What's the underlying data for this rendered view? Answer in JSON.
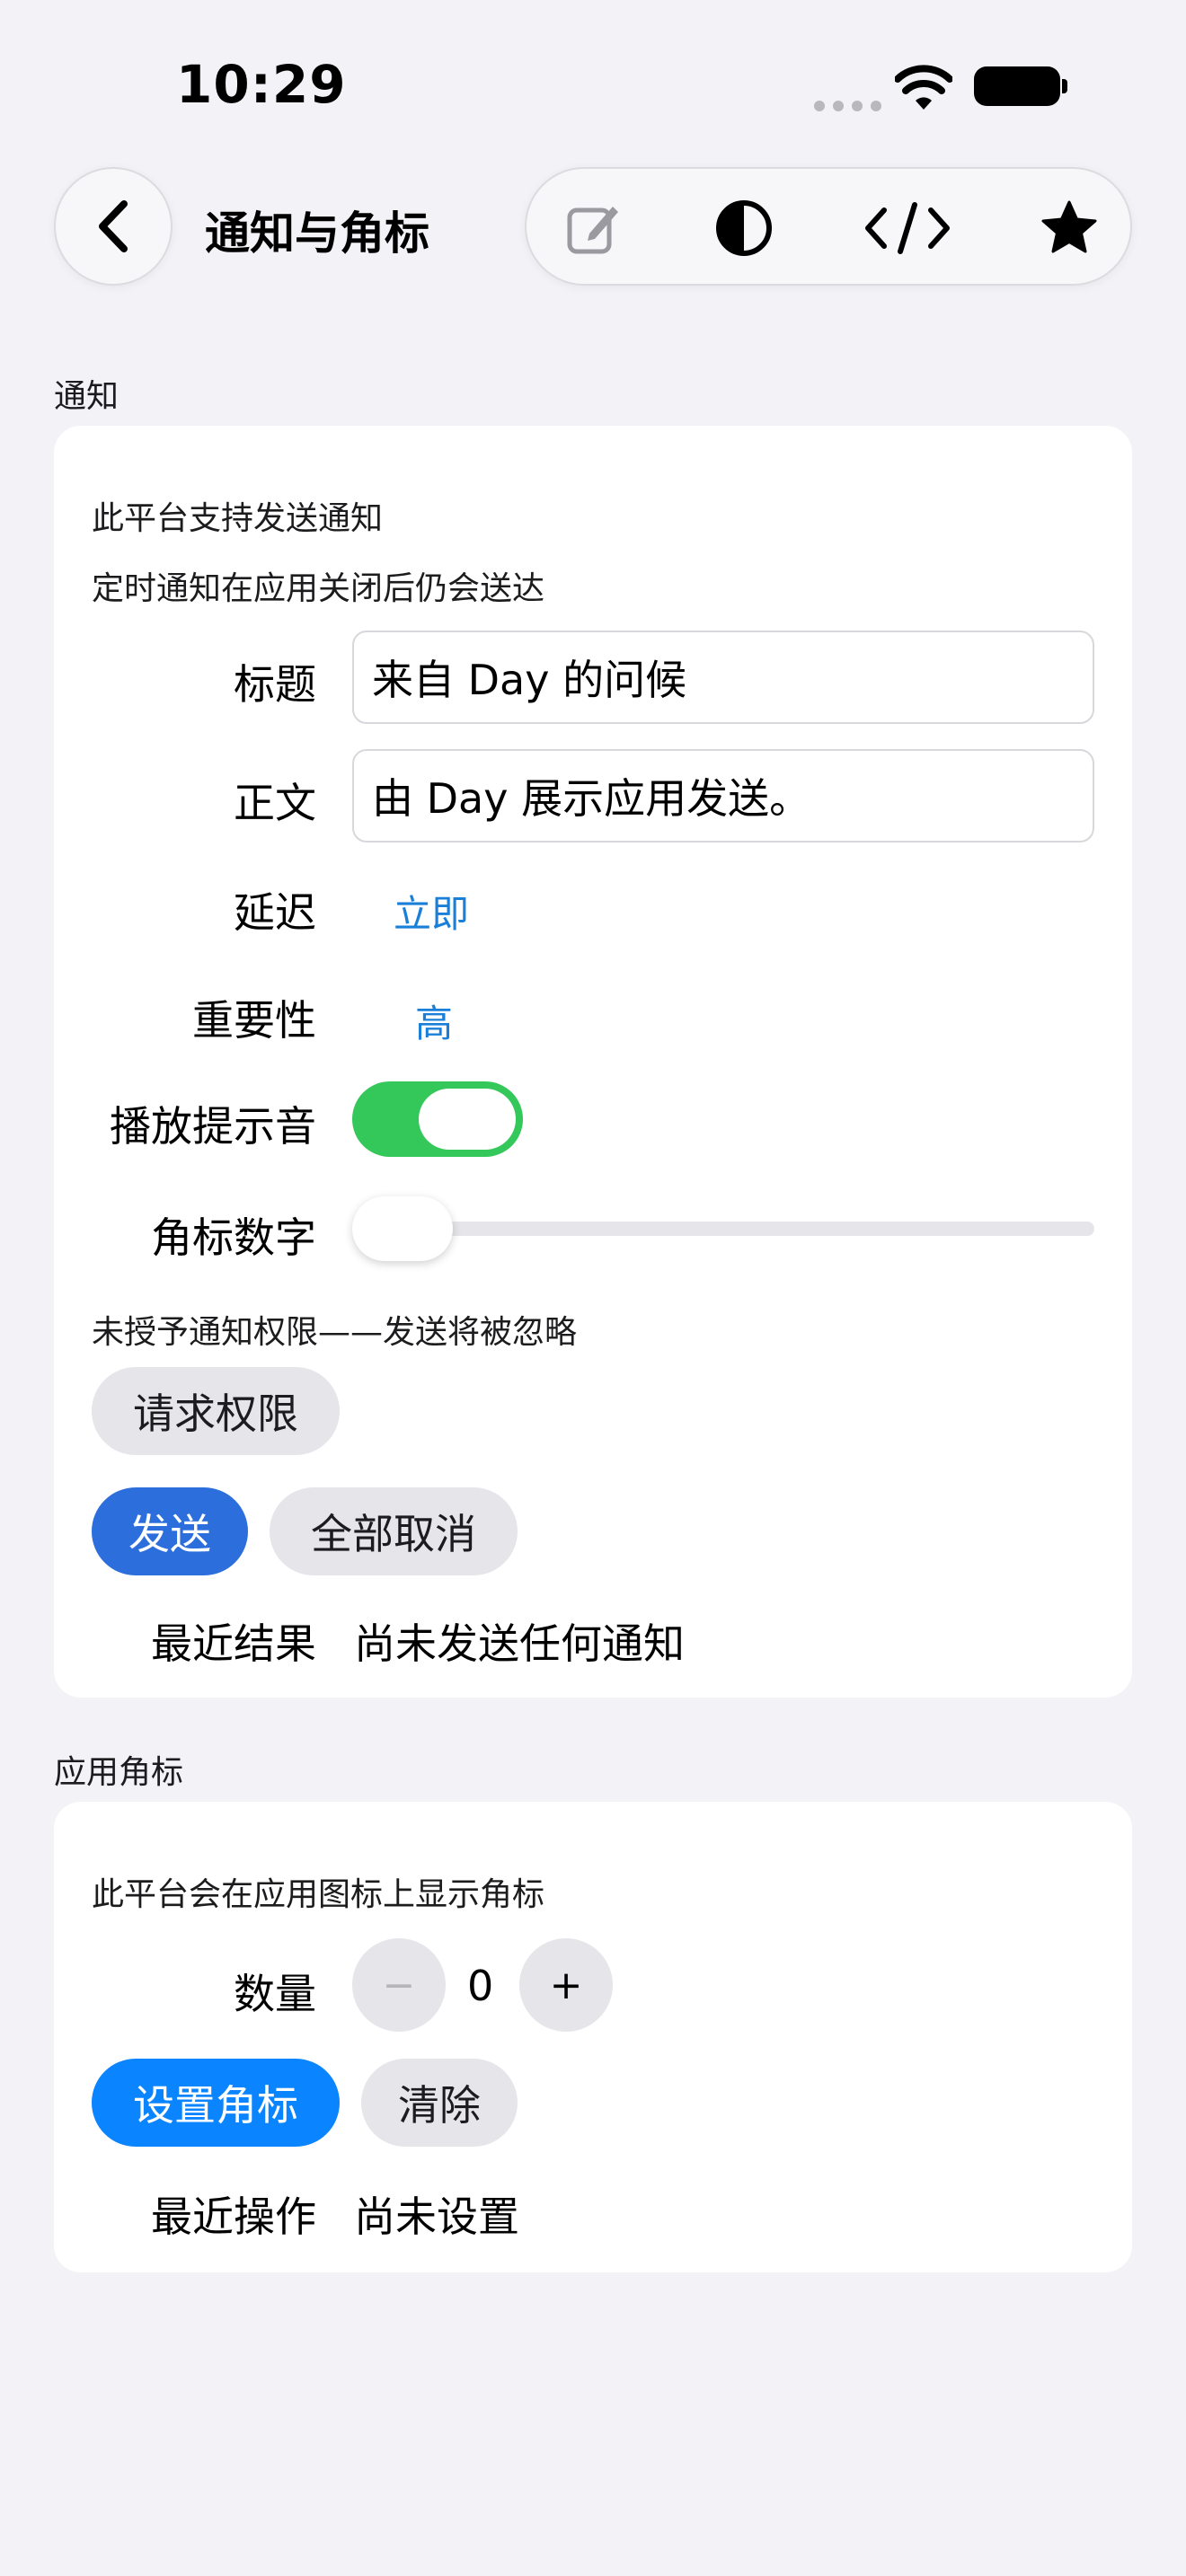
{
  "status_bar": {
    "time": "10:29"
  },
  "nav": {
    "title": "通知与角标",
    "icons": [
      "back-chevron-icon",
      "compose-icon",
      "contrast-icon",
      "code-icon",
      "star-icon"
    ]
  },
  "notification_section": {
    "header": "通知",
    "support_note": "此平台支持发送通知",
    "scheduled_note": "定时通知在应用关闭后仍会送达",
    "title_label": "标题",
    "title_value": "来自 Day 的问候",
    "body_label": "正文",
    "body_value": "由 Day 展示应用发送。",
    "delay_label": "延迟",
    "delay_value": "立即",
    "importance_label": "重要性",
    "importance_value": "高",
    "sound_label": "播放提示音",
    "sound_on": true,
    "badge_number_label": "角标数字",
    "badge_number_slider_fraction": 0,
    "permission_note": "未授予通知权限——发送将被忽略",
    "request_permission_button": "请求权限",
    "send_button": "发送",
    "cancel_all_button": "全部取消",
    "last_result_label": "最近结果",
    "last_result_value": "尚未发送任何通知"
  },
  "badge_section": {
    "header": "应用角标",
    "support_note": "此平台会在应用图标上显示角标",
    "quantity_label": "数量",
    "decrement": "−",
    "quantity_value": "0",
    "increment": "+",
    "set_badge_button": "设置角标",
    "clear_button": "清除",
    "last_action_label": "最近操作",
    "last_action_value": "尚未设置"
  },
  "colors": {
    "background": "#f2f2f7",
    "accent_blue": "#0a84ff",
    "send_blue": "#2c6fdc",
    "toggle_green": "#34c759",
    "link_blue": "#1a7fd8"
  }
}
